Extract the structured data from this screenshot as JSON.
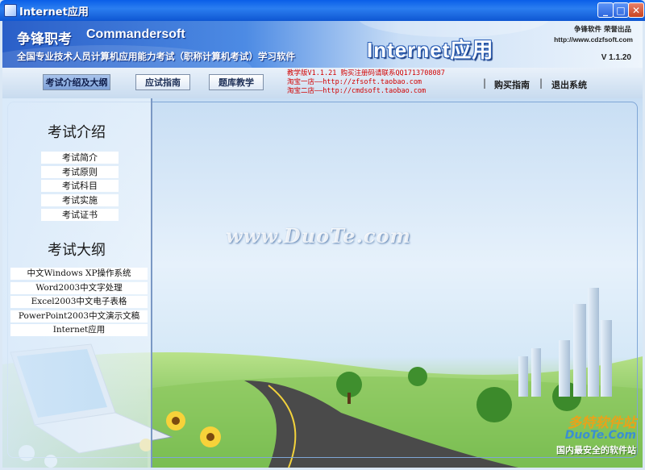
{
  "window": {
    "title": "Internet应用",
    "minimize": "_",
    "maximize": "□",
    "close": "✕"
  },
  "header": {
    "brand_cn": "争锋职考",
    "brand_en": "Commandersoft",
    "subtitle": "全国专业技术人员计算机应用能力考试（职称计算机考试）学习软件",
    "app_title": "Internet应用",
    "company": "争锋软件 荣誉出品",
    "url": "http://www.cdzfsoft.com",
    "version": "V 1.1.20"
  },
  "nav": {
    "buttons": [
      "考试介绍及大纲",
      "应试指南",
      "题库教学"
    ],
    "promo": [
      "教学版V1.1.21  购买注册码请联系QQ1713708087",
      "淘宝一店——http://zfsoft.taobao.com",
      "淘宝二店——http://cmdsoft.taobao.com"
    ],
    "links": [
      "购买指南",
      "退出系统"
    ],
    "separator": "|"
  },
  "sidebar": {
    "section1_title": "考试介绍",
    "section1_items": [
      "考试简介",
      "考试原则",
      "考试科目",
      "考试实施",
      "考试证书"
    ],
    "section2_title": "考试大纲",
    "section2_items": [
      "中文Windows XP操作系统",
      "Word2003中文字处理",
      "Excel2003中文电子表格",
      "PowerPoint2003中文演示文稿",
      "Internet应用"
    ]
  },
  "watermarks": {
    "center": "www.DuoTe.com",
    "corner_cn": "多特软件站",
    "corner_en": "DuoTe.Com",
    "corner_slogan": "国内最安全的软件站"
  },
  "colors": {
    "titlebar": "#0a5fe8",
    "promo_text": "#d10000",
    "active_button": "#8fb0e0"
  }
}
